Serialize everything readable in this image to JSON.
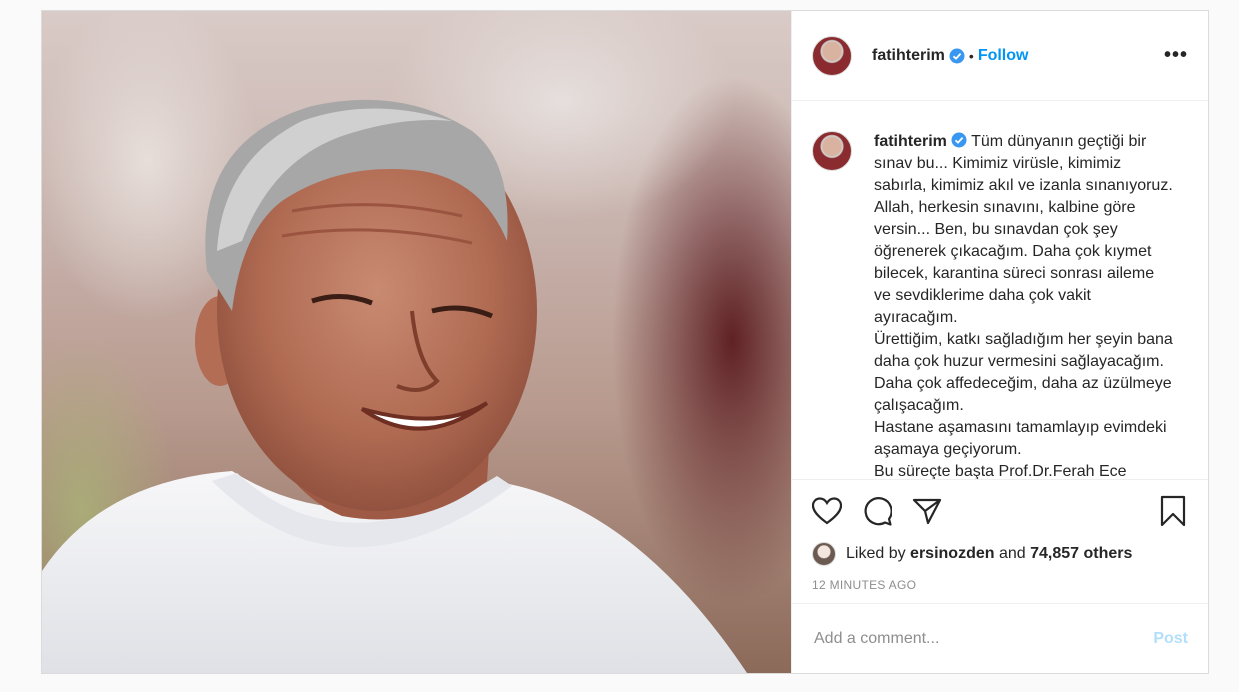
{
  "post": {
    "username": "fatihterim",
    "follow_label": "Follow",
    "separator": "•",
    "more_label": "•••",
    "caption_username": "fatihterim",
    "caption": "Tüm dünyanın geçtiği bir sınav bu... Kimimiz virüsle, kimimiz sabırla, kimimiz akıl ve izanla sınanıyoruz. Allah, herkesin sınavını, kalbine göre versin... Ben, bu sınavdan çok şey öğrenerek çıkacağım. Daha çok kıymet bilecek, karantina süreci sonrası aileme ve sevdiklerime daha çok vakit ayıracağım.\nÜrettiğim, katkı sağladığım her şeyin bana daha çok huzur vermesini sağlayacağım. Daha çok affedeceğim, daha az üzülmeye çalışacağım.\nHastane aşamasını tamamlayıp evimdeki aşamaya geçiyorum.\nBu süreçte başta Prof.Dr.Ferah Ece",
    "liked_by_prefix": "Liked by",
    "liked_by_user": "ersinozden",
    "liked_by_and": "and",
    "likes_count": "74,857 others",
    "timestamp": "12 minutes ago",
    "comment_placeholder": "Add a comment...",
    "post_button": "Post"
  },
  "icons": {
    "verified": "verified-badge-icon",
    "like": "heart-icon",
    "comment": "comment-bubble-icon",
    "share": "paper-plane-icon",
    "save": "bookmark-icon"
  },
  "colors": {
    "accent": "#0095f6",
    "post_disabled": "#b2dffc",
    "muted": "#8e8e8e",
    "text": "#262626",
    "border": "#dbdbdb"
  }
}
